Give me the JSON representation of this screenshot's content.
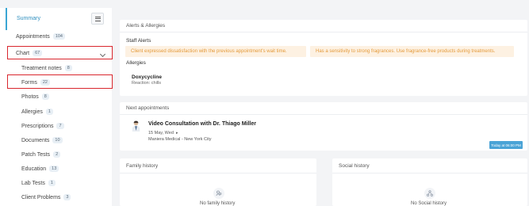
{
  "sidebar": {
    "summary_label": "Summary",
    "items": [
      {
        "label": "Appointments",
        "count": "104"
      },
      {
        "label": "Chart",
        "count": "67"
      },
      {
        "label": "Treatment notes",
        "count": "8"
      },
      {
        "label": "Forms",
        "count": "22"
      },
      {
        "label": "Photos",
        "count": "8"
      },
      {
        "label": "Allergies",
        "count": "1"
      },
      {
        "label": "Prescriptions",
        "count": "7"
      },
      {
        "label": "Documents",
        "count": "10"
      },
      {
        "label": "Patch Tests",
        "count": "2"
      },
      {
        "label": "Education",
        "count": "13"
      },
      {
        "label": "Lab Tests",
        "count": "1"
      },
      {
        "label": "Client Problems",
        "count": "3"
      }
    ]
  },
  "alerts_card": {
    "title": "Alerts & Allergies",
    "staff_alerts_label": "Staff Alerts",
    "alerts": [
      "Client expressed dissatisfaction with the previous appointment's wait time.",
      "Has a sensitivity to strong fragrances. Use fragrance-free products during treatments."
    ],
    "allergies_label": "Allergies",
    "allergy_name": "Doxycycline",
    "allergy_reaction": "Reaction: chills"
  },
  "appointments_card": {
    "title": "Next appointments",
    "appointment_title": "Video Consultation with Dr. Thiago Miller",
    "date": "15 May, Wed",
    "location": "Maniera Medical - New York City",
    "badge": "Today at 06:00 PM"
  },
  "family_history": {
    "title": "Family history",
    "empty_text": "No family history"
  },
  "social_history": {
    "title": "Social history",
    "empty_text": "No Social history"
  },
  "colors": {
    "accent": "#3aa6d4",
    "alert_bg": "#fdf1e2",
    "alert_text": "#e49a3a",
    "highlight": "#d9272e"
  }
}
